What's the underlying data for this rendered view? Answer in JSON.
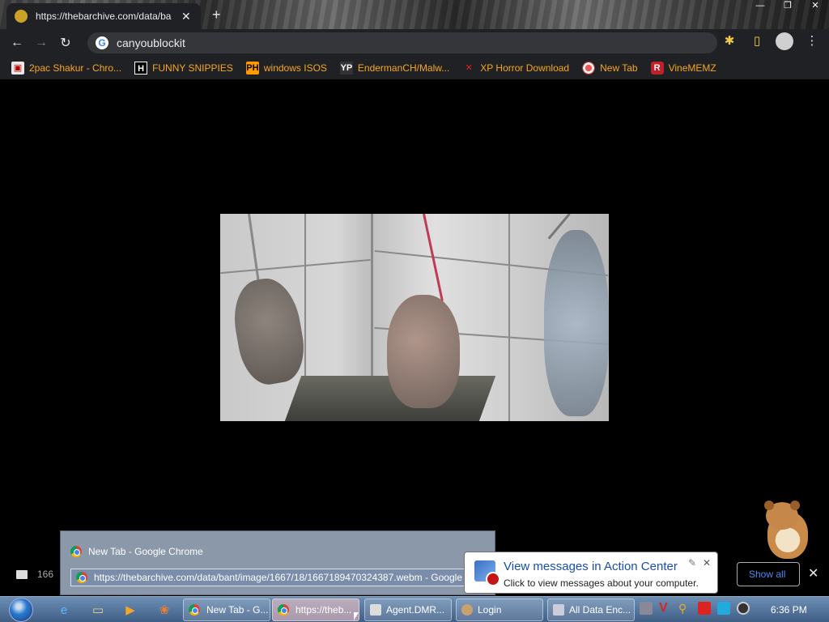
{
  "browser": {
    "tab_title": "https://thebarchive.com/data/ba",
    "address": "canyoublockit",
    "bookmarks": [
      {
        "label": "2pac Shakur - Chro...",
        "icon": "2pac-icon"
      },
      {
        "label": "FUNNY SNIPPIES",
        "icon": "h-icon"
      },
      {
        "label": "windows ISOS",
        "icon": "ph-icon"
      },
      {
        "label": "EndermanCH/Malw...",
        "icon": "yp-icon"
      },
      {
        "label": "XP Horror Download",
        "icon": "x-icon"
      },
      {
        "label": "New Tab",
        "icon": "globe-icon"
      },
      {
        "label": "VineMEMZ",
        "icon": "r-icon"
      }
    ],
    "colors": {
      "bookmark_text": "#f5a623",
      "toolbar_bg": "#202124"
    }
  },
  "thumbnail_popup": {
    "row1": "New Tab - Google Chrome",
    "row2": "https://thebarchive.com/data/bant/image/1667/18/1667189470324387.webm - Google Chrome"
  },
  "download_bar": {
    "partial_name": "166",
    "show_all_label": "Show all"
  },
  "notification": {
    "title": "View messages in Action Center",
    "text": "Click to view messages about your computer."
  },
  "taskbar": {
    "buttons": [
      {
        "label": "New Tab - G...",
        "icon": "chrome-icon"
      },
      {
        "label": "https://theb...",
        "icon": "chrome-icon",
        "active": true
      },
      {
        "label": "Agent.DMR...",
        "icon": "window-icon"
      },
      {
        "label": "Login",
        "icon": "user-icon"
      },
      {
        "label": "All Data Enc...",
        "icon": "window-icon"
      }
    ],
    "clock": "6:36 PM"
  }
}
